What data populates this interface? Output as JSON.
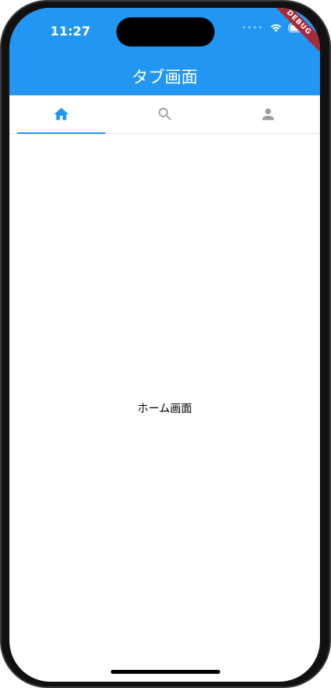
{
  "status_bar": {
    "time": "11:27",
    "debug_label": "DEBUG"
  },
  "app_bar": {
    "title": "タブ画面",
    "color": "#2196f3"
  },
  "tabs": [
    {
      "icon": "home-icon",
      "active": true
    },
    {
      "icon": "search-icon",
      "active": false
    },
    {
      "icon": "person-icon",
      "active": false
    }
  ],
  "body": {
    "center_text": "ホーム画面"
  },
  "colors": {
    "active_tab": "#2196f3",
    "inactive_tab": "#9e9e9e"
  }
}
